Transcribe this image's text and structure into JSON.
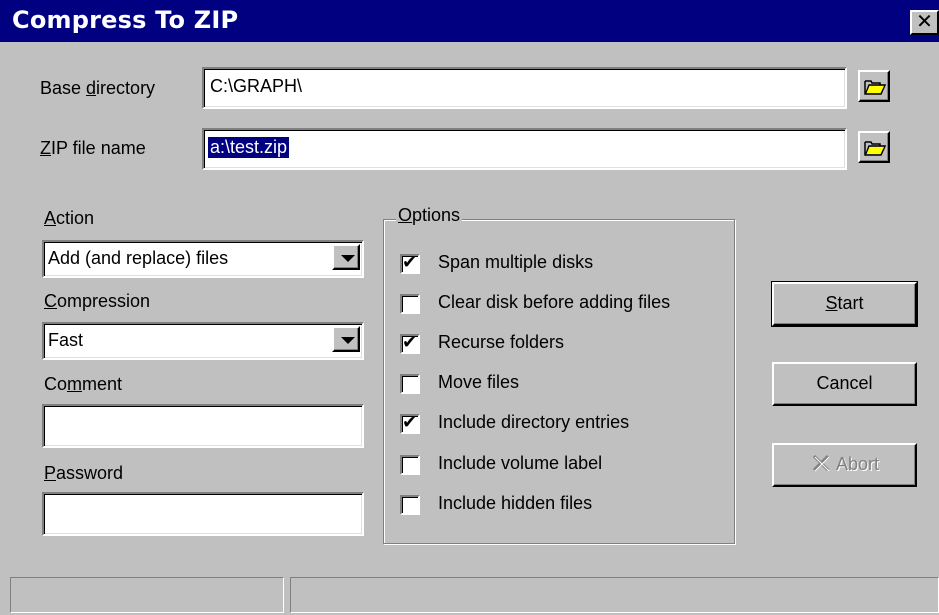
{
  "window": {
    "title": "Compress To ZIP",
    "close_glyph": "✕"
  },
  "base_directory": {
    "label_pre": "Base ",
    "label_hotkey": "d",
    "label_post": "irectory",
    "value": "C:\\GRAPH\\",
    "browse_icon": "folder-open-icon"
  },
  "zip_file": {
    "label_pre": "",
    "label_hotkey": "Z",
    "label_post": "IP file name",
    "value": "a:\\test.zip",
    "browse_icon": "folder-open-icon"
  },
  "action": {
    "label_hotkey": "A",
    "label_post": "ction",
    "selected": "Add (and replace) files"
  },
  "compression": {
    "label_hotkey": "C",
    "label_post": "ompression",
    "selected": "Fast"
  },
  "comment": {
    "label_pre": "Co",
    "label_hotkey": "m",
    "label_post": "ment",
    "value": ""
  },
  "password": {
    "label_hotkey": "P",
    "label_post": "assword",
    "value": ""
  },
  "options": {
    "label_hotkey": "O",
    "label_post": "ptions",
    "items": [
      {
        "label": "Span multiple disks",
        "checked": true
      },
      {
        "label": "Clear disk before adding files",
        "checked": false
      },
      {
        "label": "Recurse folders",
        "checked": true
      },
      {
        "label": "Move files",
        "checked": false
      },
      {
        "label": "Include directory entries",
        "checked": true
      },
      {
        "label": "Include volume label",
        "checked": false
      },
      {
        "label": "Include hidden files",
        "checked": false
      }
    ]
  },
  "buttons": {
    "start_hotkey": "S",
    "start_post": "tart",
    "cancel": "Cancel",
    "abort": "Abort",
    "abort_icon": "abort-x-icon"
  },
  "status": {
    "panel1": "",
    "panel2": ""
  },
  "check_glyph": "✔"
}
